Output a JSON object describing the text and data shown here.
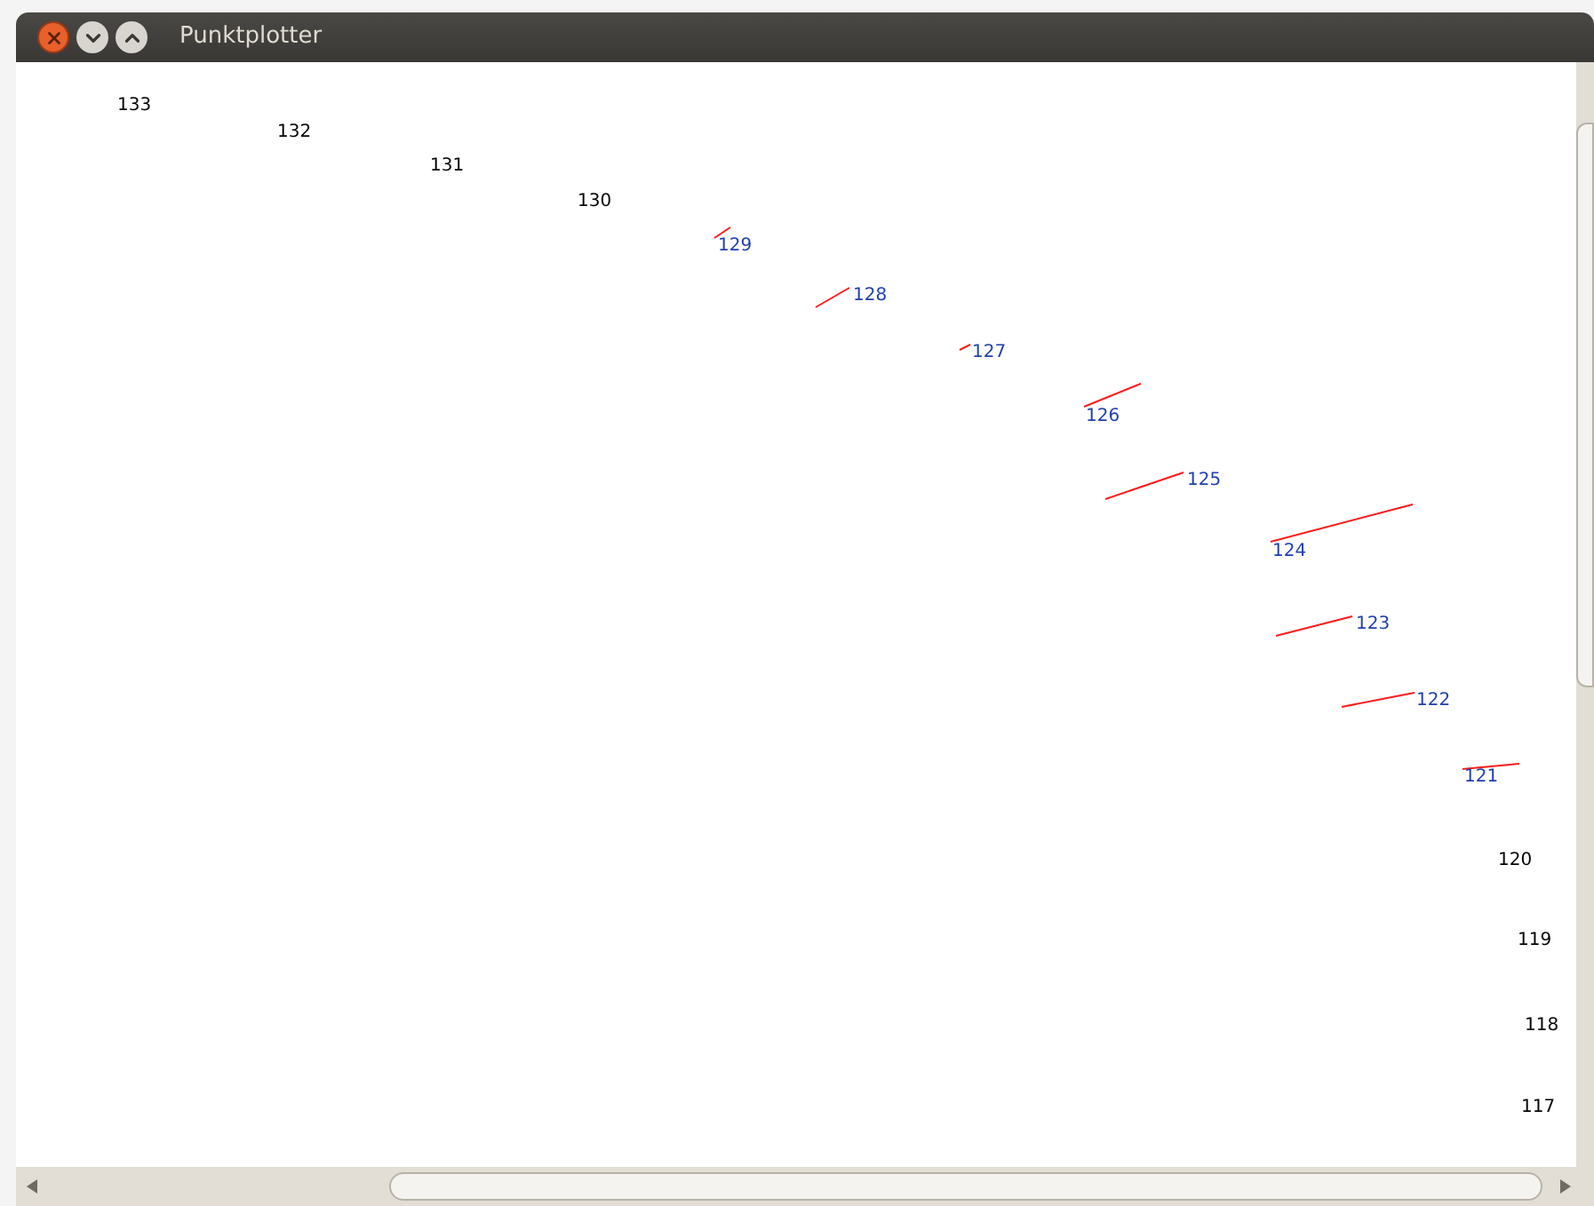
{
  "window": {
    "title": "Punktplotter"
  },
  "points": [
    {
      "label": "133",
      "highlighted": false
    },
    {
      "label": "132",
      "highlighted": false
    },
    {
      "label": "131",
      "highlighted": false
    },
    {
      "label": "130",
      "highlighted": false
    },
    {
      "label": "129",
      "highlighted": true
    },
    {
      "label": "128",
      "highlighted": true
    },
    {
      "label": "127",
      "highlighted": true
    },
    {
      "label": "126",
      "highlighted": true
    },
    {
      "label": "125",
      "highlighted": true
    },
    {
      "label": "124",
      "highlighted": true
    },
    {
      "label": "123",
      "highlighted": true
    },
    {
      "label": "122",
      "highlighted": true
    },
    {
      "label": "121",
      "highlighted": true
    },
    {
      "label": "120",
      "highlighted": false
    },
    {
      "label": "119",
      "highlighted": false
    },
    {
      "label": "118",
      "highlighted": false
    },
    {
      "label": "117",
      "highlighted": false
    }
  ]
}
